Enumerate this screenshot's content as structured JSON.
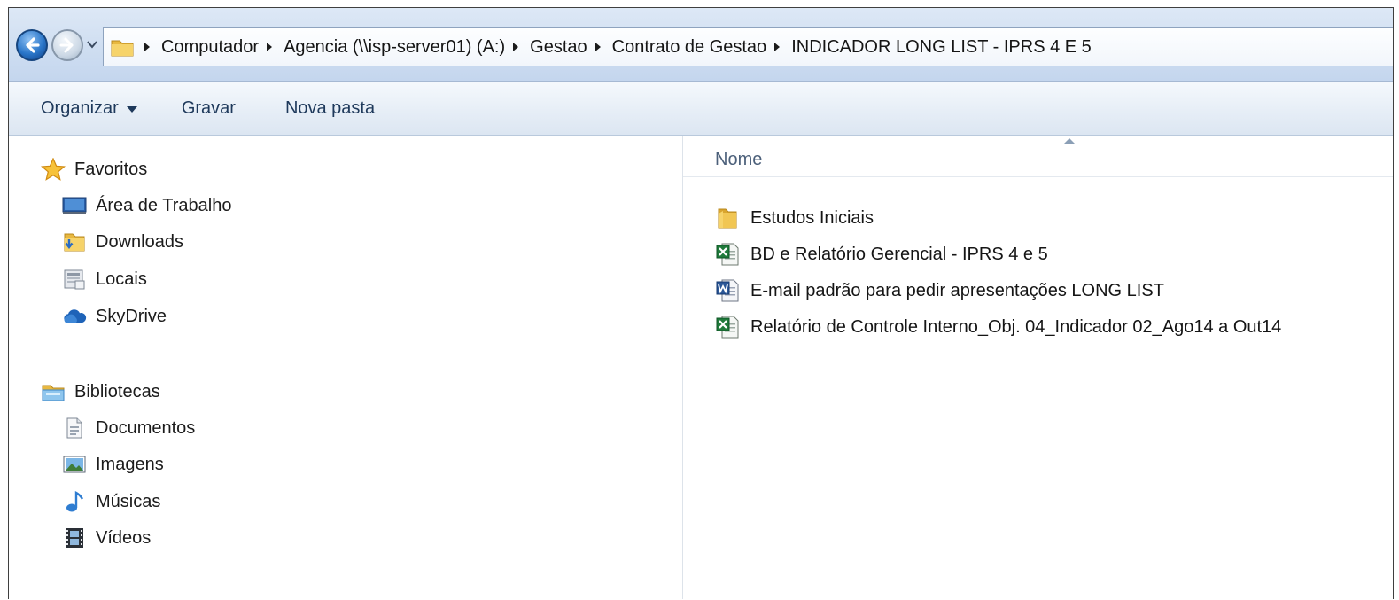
{
  "address_bar": {
    "breadcrumbs": [
      "Computador",
      "Agencia (\\\\isp-server01) (A:)",
      "Gestao",
      "Contrato de Gestao",
      "INDICADOR LONG LIST - IPRS 4 E 5"
    ]
  },
  "toolbar": {
    "organize_label": "Organizar",
    "burn_label": "Gravar",
    "new_folder_label": "Nova pasta"
  },
  "nav": {
    "favorites": {
      "label": "Favoritos",
      "icon": "star-icon",
      "items": [
        {
          "label": "Área de Trabalho",
          "icon": "desktop-icon"
        },
        {
          "label": "Downloads",
          "icon": "downloads-folder-icon"
        },
        {
          "label": "Locais",
          "icon": "recent-places-icon"
        },
        {
          "label": "SkyDrive",
          "icon": "skydrive-cloud-icon"
        }
      ]
    },
    "libraries": {
      "label": "Bibliotecas",
      "icon": "libraries-icon",
      "items": [
        {
          "label": "Documentos",
          "icon": "documents-icon"
        },
        {
          "label": "Imagens",
          "icon": "pictures-icon"
        },
        {
          "label": "Músicas",
          "icon": "music-note-icon"
        },
        {
          "label": "Vídeos",
          "icon": "video-film-icon"
        }
      ]
    }
  },
  "content": {
    "column_header": "Nome",
    "files": [
      {
        "name": "Estudos Iniciais",
        "icon": "folder-icon"
      },
      {
        "name": "BD e Relatório Gerencial - IPRS 4 e 5",
        "icon": "excel-file-icon"
      },
      {
        "name": "E-mail padrão para pedir apresentações LONG LIST",
        "icon": "word-file-icon"
      },
      {
        "name": "Relatório de Controle Interno_Obj. 04_Indicador 02_Ago14 a Out14",
        "icon": "excel-file-icon"
      }
    ]
  },
  "colors": {
    "toolbar_text": "#1e395b",
    "column_header_text": "#4c607a",
    "folder_yellow": "#e8b840",
    "excel_green": "#1f7a3a",
    "word_blue": "#2b5797"
  }
}
